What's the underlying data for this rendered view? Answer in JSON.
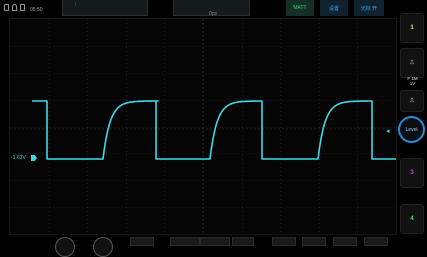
{
  "status_bar": {
    "time": "05:50",
    "icons": [
      "sim-icon",
      "wifi-icon",
      "battery-icon"
    ]
  },
  "toolbar": {
    "center_label": "0ps",
    "green_button": "MATT",
    "settings_button": "设置",
    "right_button": "光标 开"
  },
  "trace": {
    "color": "#3ed9e8",
    "left_level_label": "-1.63V"
  },
  "side_panel": {
    "btn1": "1",
    "btn2": "⎍",
    "info_line1": "F   1M",
    "info_line2": "1V",
    "btn3": "⎍",
    "level_label": "Level",
    "btn_ch3": "3",
    "btn_ch4": "4"
  }
}
